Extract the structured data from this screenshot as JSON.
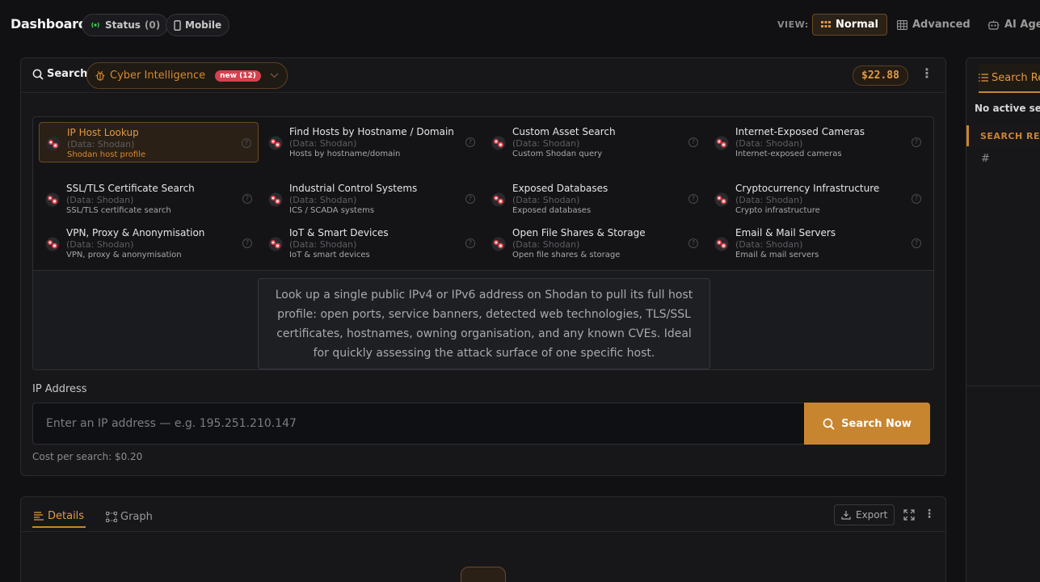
{
  "header": {
    "title": "Dashboard",
    "status_label": "Status",
    "status_count": "(0)",
    "mobile_label": "Mobile",
    "view_label": "VIEW:",
    "views": [
      "Normal",
      "Advanced",
      "AI Age"
    ]
  },
  "search": {
    "title": "Search",
    "category": "Cyber Intelligence",
    "new_badge": "new (12)",
    "credits": "$22.88"
  },
  "tools": [
    {
      "name": "IP Host Lookup",
      "source": "(Data: Shodan)",
      "desc": "Shodan host profile",
      "active": true
    },
    {
      "name": "Find Hosts by Hostname / Domain",
      "source": "(Data: Shodan)",
      "desc": "Hosts by hostname/domain",
      "active": false
    },
    {
      "name": "Custom Asset Search",
      "source": "(Data: Shodan)",
      "desc": "Custom Shodan query",
      "active": false
    },
    {
      "name": "Internet-Exposed Cameras",
      "source": "(Data: Shodan)",
      "desc": "Internet-exposed cameras",
      "active": false
    },
    {
      "name": "SSL/TLS Certificate Search",
      "source": "(Data: Shodan)",
      "desc": "SSL/TLS certificate search",
      "active": false
    },
    {
      "name": "Industrial Control Systems",
      "source": "(Data: Shodan)",
      "desc": "ICS / SCADA systems",
      "active": false
    },
    {
      "name": "Exposed Databases",
      "source": "(Data: Shodan)",
      "desc": "Exposed databases",
      "active": false
    },
    {
      "name": "Cryptocurrency Infrastructure",
      "source": "(Data: Shodan)",
      "desc": "Crypto infrastructure",
      "active": false
    },
    {
      "name": "VPN, Proxy & Anonymisation",
      "source": "(Data: Shodan)",
      "desc": "VPN, proxy & anonymisation",
      "active": false
    },
    {
      "name": "IoT & Smart Devices",
      "source": "(Data: Shodan)",
      "desc": "IoT & smart devices",
      "active": false
    },
    {
      "name": "Open File Shares & Storage",
      "source": "(Data: Shodan)",
      "desc": "Open file shares & storage",
      "active": false
    },
    {
      "name": "Email & Mail Servers",
      "source": "(Data: Shodan)",
      "desc": "Email & mail servers",
      "active": false
    }
  ],
  "description": "Look up a single public IPv4 or IPv6 address on Shodan to pull its full host profile: open ports, service banners, detected web technologies, TLS/SSL certificates, hostnames, owning organisation, and any known CVEs. Ideal for quickly assessing the attack surface of one specific host.",
  "form": {
    "ip_label": "IP Address",
    "ip_placeholder": "Enter an IP address — e.g. 195.251.210.147",
    "ip_value": "",
    "submit_label": "Search Now",
    "cost": "Cost per search: $0.20"
  },
  "details": {
    "tabs": [
      "Details",
      "Graph"
    ],
    "export_label": "Export"
  },
  "right_panel": {
    "tab_label": "Search Re",
    "empty_text": "No active sea",
    "section_label": "SEARCH RESU",
    "hash": "#"
  },
  "colors": {
    "accent": "#c8852f",
    "background": "#111113",
    "panel": "#17171a"
  }
}
